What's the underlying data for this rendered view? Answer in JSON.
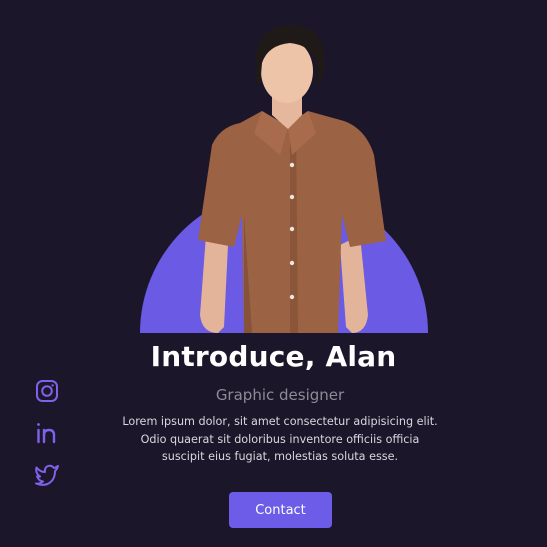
{
  "profile": {
    "title": "Introduce, Alan",
    "role": "Graphic designer",
    "description": "Lorem ipsum dolor, sit amet consectetur adipisicing elit. Odio quaerat sit doloribus inventore officiis officia suscipit eius fugiat, molestias soluta esse.",
    "contact_label": "Contact",
    "photo_alt": "Portrait of a young man in a brown short-sleeve shirt"
  },
  "social": [
    {
      "name": "instagram-icon"
    },
    {
      "name": "linkedin-icon"
    },
    {
      "name": "twitter-icon"
    }
  ],
  "colors": {
    "background": "#1b1629",
    "accent": "#6c5ce7",
    "icon": "#7c63ea",
    "text_muted": "#8e8a97"
  }
}
